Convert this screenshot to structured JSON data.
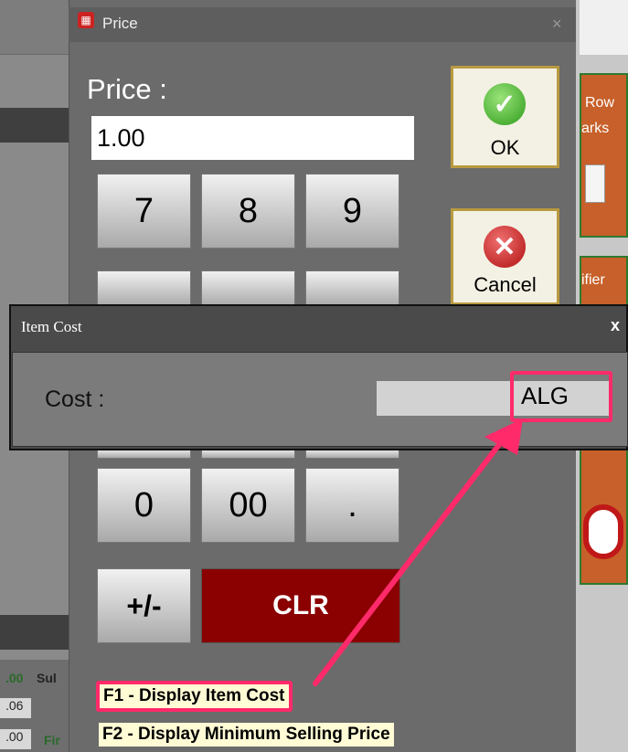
{
  "price_dialog": {
    "title": "Price",
    "price_label": "Price :",
    "price_value": "1.00",
    "keys": {
      "k7": "7",
      "k8": "8",
      "k9": "9",
      "k0": "0",
      "k00": "00",
      "kdot": ".",
      "kpm": "+/-",
      "clr": "CLR"
    },
    "ok_label": "OK",
    "cancel_label": "Cancel",
    "hint_f1": "F1 - Display Item Cost",
    "hint_f2": "F2 - Display Minimum Selling Price"
  },
  "item_cost_dialog": {
    "title": "Item Cost",
    "close_label": "x",
    "cost_label": "Cost :",
    "cost_value": "ALG"
  },
  "background": {
    "tile1_text_a": "Row",
    "tile1_text_b": "arks",
    "tile2_text": "ifier",
    "left_vals": [
      ".00",
      ".06",
      ".00"
    ],
    "left_labels": [
      "Sul",
      "Fir"
    ]
  },
  "colors": {
    "highlight": "#ff2a6a",
    "clr_button": "#8b0000",
    "hint_bg": "#fffbd5"
  }
}
